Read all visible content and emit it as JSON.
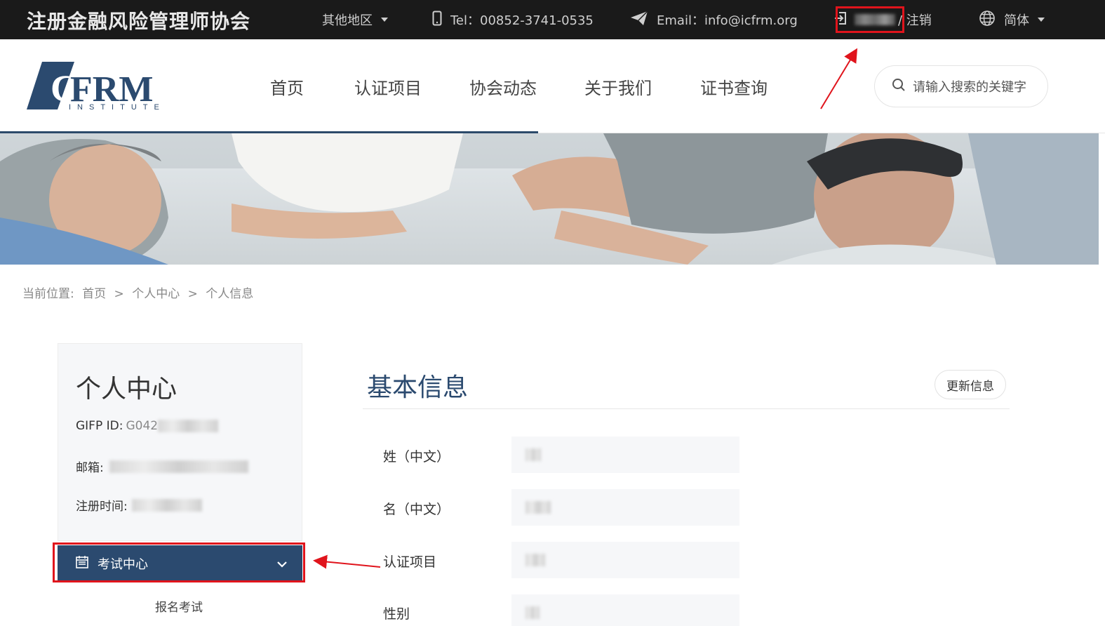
{
  "topbar": {
    "site_title": "注册金融风险管理师协会",
    "region_label": "其他地区",
    "tel_label": "Tel：00852-3741-0535",
    "email_label": "Email：info@icfrm.org",
    "logout_label": "/ 注销",
    "lang_label": "简体"
  },
  "header": {
    "logo_main": "CFRM",
    "logo_sub": "INSTITUTE",
    "nav": [
      "首页",
      "认证项目",
      "协会动态",
      "关于我们",
      "证书查询"
    ],
    "search_placeholder": "请输入搜索的关键字"
  },
  "breadcrumb": {
    "prefix": "当前位置:",
    "items": [
      "首页",
      "个人中心",
      "个人信息"
    ],
    "separator": ">"
  },
  "sidebar": {
    "title": "个人中心",
    "gifp_label": "GIFP ID:",
    "gifp_value": "G042",
    "email_label": "邮箱:",
    "reg_time_label": "注册时间:",
    "menu_exam_label": "考试中心",
    "submenu": [
      "报名考试"
    ]
  },
  "main": {
    "title": "基本信息",
    "update_button": "更新信息",
    "fields": [
      {
        "label": "姓（中文）"
      },
      {
        "label": "名（中文）"
      },
      {
        "label": "认证项目"
      },
      {
        "label": "性别"
      }
    ]
  },
  "colors": {
    "topbar_bg": "#1a1a1a",
    "brand_navy": "#2b4a6f",
    "annotation_red": "#e0141c"
  }
}
